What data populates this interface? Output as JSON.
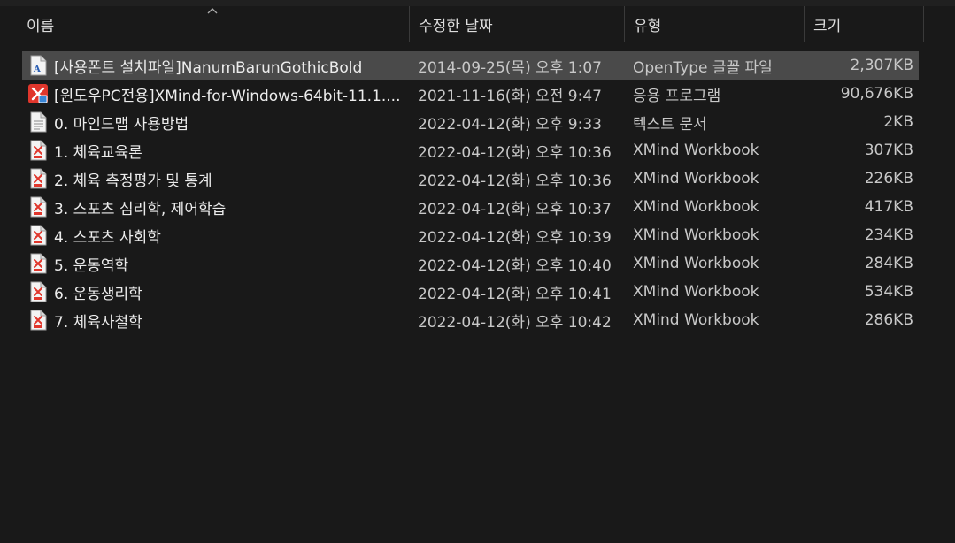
{
  "columns": {
    "name": "이름",
    "date": "수정한 날짜",
    "type": "유형",
    "size": "크기"
  },
  "files": [
    {
      "name": "[사용폰트 설치파일]NanumBarunGothicBold",
      "date": "2014-09-25(목) 오후 1:07",
      "type": "OpenType 글꼴 파일",
      "size": "2,307KB",
      "icon": "font-file-icon",
      "selected": true
    },
    {
      "name": "[윈도우PC전용]XMind-for-Windows-64bit-11.1....",
      "date": "2021-11-16(화) 오전 9:47",
      "type": "응용 프로그램",
      "size": "90,676KB",
      "icon": "xmind-app-icon",
      "selected": false
    },
    {
      "name": "0. 마인드맵 사용방법",
      "date": "2022-04-12(화) 오후 9:33",
      "type": "텍스트 문서",
      "size": "2KB",
      "icon": "text-document-icon",
      "selected": false
    },
    {
      "name": "1. 체육교육론",
      "date": "2022-04-12(화) 오후 10:36",
      "type": "XMind Workbook",
      "size": "307KB",
      "icon": "xmind-file-icon",
      "selected": false
    },
    {
      "name": "2. 체육 측정평가 및 통계",
      "date": "2022-04-12(화) 오후 10:36",
      "type": "XMind Workbook",
      "size": "226KB",
      "icon": "xmind-file-icon",
      "selected": false
    },
    {
      "name": "3. 스포츠 심리학, 제어학습",
      "date": "2022-04-12(화) 오후 10:37",
      "type": "XMind Workbook",
      "size": "417KB",
      "icon": "xmind-file-icon",
      "selected": false
    },
    {
      "name": "4. 스포츠 사회학",
      "date": "2022-04-12(화) 오후 10:39",
      "type": "XMind Workbook",
      "size": "234KB",
      "icon": "xmind-file-icon",
      "selected": false
    },
    {
      "name": "5. 운동역학",
      "date": "2022-04-12(화) 오후 10:40",
      "type": "XMind Workbook",
      "size": "284KB",
      "icon": "xmind-file-icon",
      "selected": false
    },
    {
      "name": "6. 운동생리학",
      "date": "2022-04-12(화) 오후 10:41",
      "type": "XMind Workbook",
      "size": "534KB",
      "icon": "xmind-file-icon",
      "selected": false
    },
    {
      "name": "7. 체육사철학",
      "date": "2022-04-12(화) 오후 10:42",
      "type": "XMind Workbook",
      "size": "286KB",
      "icon": "xmind-file-icon",
      "selected": false
    }
  ],
  "colors": {
    "background": "#191919",
    "selected_row": "#4a4a4a",
    "xmind_red": "#e0362c"
  }
}
